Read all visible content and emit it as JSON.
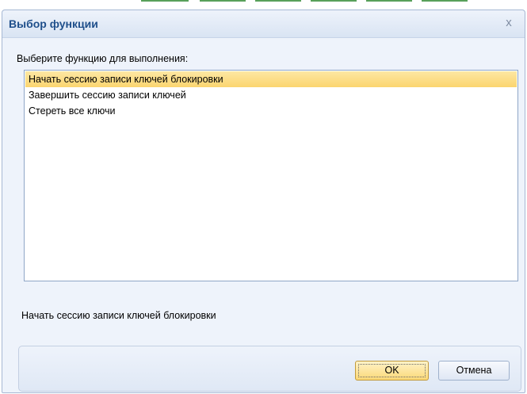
{
  "dialog": {
    "title": "Выбор функции",
    "close_glyph": "x"
  },
  "prompt": "Выберите функцию для выполнения:",
  "functions": {
    "items": [
      {
        "label": "Начать сессию записи ключей блокировки",
        "selected": true
      },
      {
        "label": "Завершить сессию записи ключей",
        "selected": false
      },
      {
        "label": "Стереть все ключи",
        "selected": false
      }
    ]
  },
  "description": "Начать сессию записи ключей блокировки",
  "buttons": {
    "ok_label": "OK",
    "cancel_label": "Отмена"
  },
  "colors": {
    "title_text": "#1f4f8b",
    "selection": "#fbd56f",
    "dialog_background": "#eef3fb",
    "border": "#8fa6c7"
  }
}
